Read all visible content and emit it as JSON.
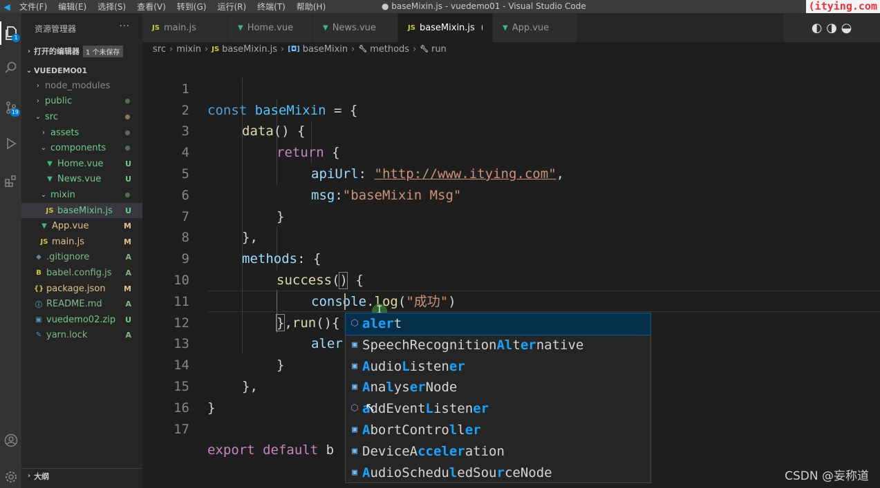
{
  "titlebar": {
    "menu": [
      "文件(F)",
      "编辑(E)",
      "选择(S)",
      "查看(V)",
      "转到(G)",
      "运行(R)",
      "终端(T)",
      "帮助(H)"
    ],
    "title": "● baseMixin.js - vuedemo01 - Visual Studio Code",
    "brand": "(itying.com"
  },
  "activity": {
    "explorer_badge": "1",
    "scm_badge": "19"
  },
  "sidebar": {
    "header": "资源管理器",
    "more": "···",
    "open_editors": {
      "label": "打开的编辑器",
      "unsaved": "1 个未保存"
    },
    "project": "VUEDEMO01",
    "items": [
      {
        "name": "node_modules",
        "status": ""
      },
      {
        "name": "public",
        "status": ""
      },
      {
        "name": "src",
        "status": ""
      },
      {
        "name": "assets",
        "status": ""
      },
      {
        "name": "components",
        "status": ""
      },
      {
        "name": "Home.vue",
        "status": "U"
      },
      {
        "name": "News.vue",
        "status": "U"
      },
      {
        "name": "mixin",
        "status": ""
      },
      {
        "name": "baseMixin.js",
        "status": "U"
      },
      {
        "name": "App.vue",
        "status": "M"
      },
      {
        "name": "main.js",
        "status": "M"
      },
      {
        "name": ".gitignore",
        "status": "A"
      },
      {
        "name": "babel.config.js",
        "status": "A"
      },
      {
        "name": "package.json",
        "status": "M"
      },
      {
        "name": "README.md",
        "status": "A"
      },
      {
        "name": "vuedemo02.zip",
        "status": "U"
      },
      {
        "name": "yarn.lock",
        "status": "A"
      }
    ],
    "outline": "大纲"
  },
  "tabs": [
    {
      "label": "main.js",
      "icon": "JS"
    },
    {
      "label": "Home.vue",
      "icon": "V"
    },
    {
      "label": "News.vue",
      "icon": "V"
    },
    {
      "label": "baseMixin.js",
      "icon": "JS"
    },
    {
      "label": "App.vue",
      "icon": "V"
    }
  ],
  "breadcrumb": [
    "src",
    "mixin",
    "baseMixin.js",
    "baseMixin",
    "methods",
    "run"
  ],
  "editor": {
    "line_numbers": [
      "1",
      "2",
      "3",
      "4",
      "5",
      "6",
      "7",
      "8",
      "9",
      "10",
      "11",
      "12",
      "13",
      "14",
      "15",
      "16",
      "17"
    ],
    "l1": {
      "kw": "const",
      "name": "baseMixin",
      "rest": " = {"
    },
    "l2": {
      "fn": "data",
      "rest": "() {"
    },
    "l3": {
      "kw": "return",
      "rest": " {"
    },
    "l4": {
      "prop": "apiUrl",
      "colon": ": ",
      "str": "\"http://www.itying.com\"",
      "rest": ","
    },
    "l5": {
      "prop": "msg",
      "colon": ":",
      "str": "\"baseMixin Msg\""
    },
    "l6": "}",
    "l7": "},",
    "l8": {
      "prop": "methods",
      "rest": ": {"
    },
    "l9": {
      "fn": "success",
      "rest": "() {"
    },
    "l10": {
      "obj": "console",
      "dot": ".",
      "fn": "log",
      "open": "(",
      "str": "\"成功\"",
      "close": ")"
    },
    "l11": {
      "pre": "},",
      "fn": "run",
      "paren": "()",
      "brace": "{"
    },
    "l12": {
      "typed": "aler"
    },
    "l13": "}",
    "l14": "},",
    "l15": "}",
    "l17": {
      "kw": "export default",
      "rest": " b"
    }
  },
  "suggest": {
    "items": [
      {
        "kind": "method",
        "parts": [
          [
            "al",
            true
          ],
          [
            "er",
            true
          ],
          [
            "t",
            false
          ]
        ]
      },
      {
        "kind": "variable",
        "parts": [
          [
            "SpeechRecognition",
            false
          ],
          [
            "Al",
            true
          ],
          [
            "t",
            false
          ],
          [
            "er",
            true
          ],
          [
            "native",
            false
          ]
        ]
      },
      {
        "kind": "variable",
        "parts": [
          [
            "A",
            true
          ],
          [
            "udio",
            false
          ],
          [
            "L",
            true
          ],
          [
            "isten",
            false
          ],
          [
            "er",
            true
          ]
        ]
      },
      {
        "kind": "variable",
        "parts": [
          [
            "A",
            true
          ],
          [
            "na",
            false
          ],
          [
            "l",
            true
          ],
          [
            "ys",
            false
          ],
          [
            "er",
            true
          ],
          [
            "Node",
            false
          ]
        ]
      },
      {
        "kind": "method",
        "parts": [
          [
            "a",
            true
          ],
          [
            "ddEvent",
            false
          ],
          [
            "L",
            true
          ],
          [
            "isten",
            false
          ],
          [
            "er",
            true
          ]
        ]
      },
      {
        "kind": "variable",
        "parts": [
          [
            "A",
            true
          ],
          [
            "bortContro",
            false
          ],
          [
            "l",
            true
          ],
          [
            "l",
            false
          ],
          [
            "er",
            true
          ]
        ]
      },
      {
        "kind": "variable",
        "parts": [
          [
            "DeviceA",
            false
          ],
          [
            "ccel",
            true
          ],
          [
            "er",
            true
          ],
          [
            "ation",
            false
          ]
        ]
      },
      {
        "kind": "variable",
        "parts": [
          [
            "A",
            true
          ],
          [
            "udioSchedu",
            false
          ],
          [
            "l",
            true
          ],
          [
            "edSou",
            false
          ],
          [
            "r",
            true
          ],
          [
            "ceNode",
            false
          ]
        ]
      }
    ]
  },
  "watermark": "CSDN @妄称道"
}
